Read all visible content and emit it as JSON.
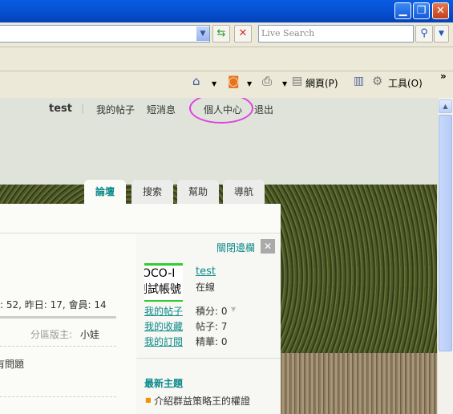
{
  "window": {
    "minimize": "▁",
    "restore": "❐",
    "close": "✕"
  },
  "toolbar": {
    "search_placeholder": "Live Search",
    "home": "⌂",
    "feed": "◙",
    "print": "⎙",
    "page_label": "網頁(P)",
    "tools_label": "工具(O)",
    "more": "»"
  },
  "topnav": {
    "user": "test",
    "sep": "|",
    "items": [
      "我的帖子",
      "短消息",
      "個人中心",
      "退出"
    ]
  },
  "tabs": [
    "論壇",
    "搜索",
    "幫助",
    "導航"
  ],
  "main": {
    "stats": ": 52, 昨日: 17, 會員: 14",
    "moderator_label": "分區版主:",
    "moderator": "小娃",
    "row1": "有問題"
  },
  "sidebar": {
    "close_label": "關閉邊欄",
    "avatar_text": [
      "OCO-I",
      "測試帳號"
    ],
    "username": "test",
    "status": "在線",
    "links": [
      "我的帖子",
      "我的收藏",
      "我的訂閱"
    ],
    "stats": [
      "積分: 0",
      "帖子: 7",
      "精華: 0"
    ],
    "latest_title": "最新主題",
    "latest_items": [
      "介紹群益策略王的權證"
    ]
  },
  "colors": {
    "accent": "#0a8a8a",
    "highlight": "#e040e0"
  }
}
